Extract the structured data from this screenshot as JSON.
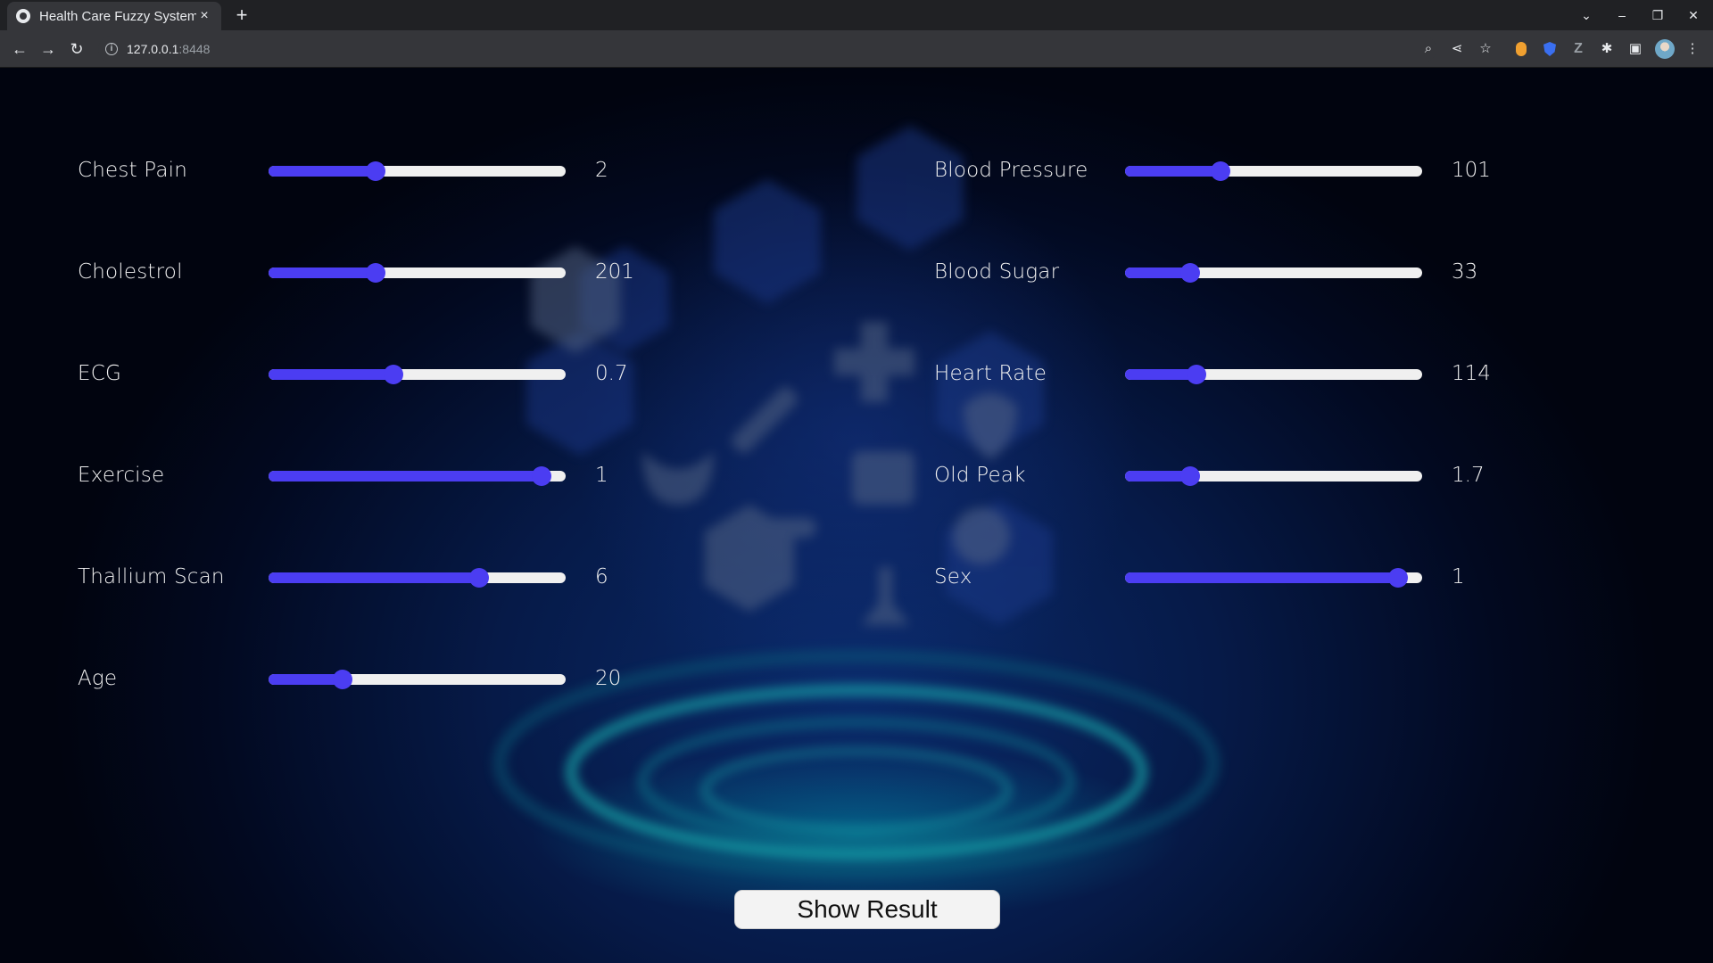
{
  "browser": {
    "tab_title": "Health Care Fuzzy System",
    "tab_close": "×",
    "new_tab": "+",
    "url_host": "127.0.0.1",
    "url_port": ":8448",
    "window_controls": {
      "list": "⌄",
      "minimize": "–",
      "restore": "❐",
      "close": "✕"
    },
    "nav": {
      "back": "←",
      "forward": "→",
      "reload": "↻"
    },
    "toolbar_icons": {
      "zoom": "⌕",
      "share": "⋖",
      "bookmark": "☆",
      "extensions": "✱",
      "sidebar": "▣",
      "menu": "⋮"
    }
  },
  "form": {
    "left": [
      {
        "label": "Chest Pain",
        "value": "2",
        "level": 0.36
      },
      {
        "label": "Cholestrol",
        "value": "201",
        "level": 0.36
      },
      {
        "label": "ECG",
        "value": "0.7",
        "level": 0.42
      },
      {
        "label": "Exercise",
        "value": "1",
        "level": 0.92
      },
      {
        "label": "Thallium Scan",
        "value": "6",
        "level": 0.71
      },
      {
        "label": "Age",
        "value": "20",
        "level": 0.25
      }
    ],
    "right": [
      {
        "label": "Blood Pressure",
        "value": "101",
        "level": 0.32
      },
      {
        "label": "Blood Sugar",
        "value": "33",
        "level": 0.22
      },
      {
        "label": "Heart Rate",
        "value": "114",
        "level": 0.24
      },
      {
        "label": "Old Peak",
        "value": "1.7",
        "level": 0.22
      },
      {
        "label": "Sex",
        "value": "1",
        "level": 0.92
      }
    ]
  },
  "submit_label": "Show Result",
  "colors": {
    "accent": "#4b3df2",
    "track": "#f0f0f0",
    "text": "#f2f2f2"
  }
}
